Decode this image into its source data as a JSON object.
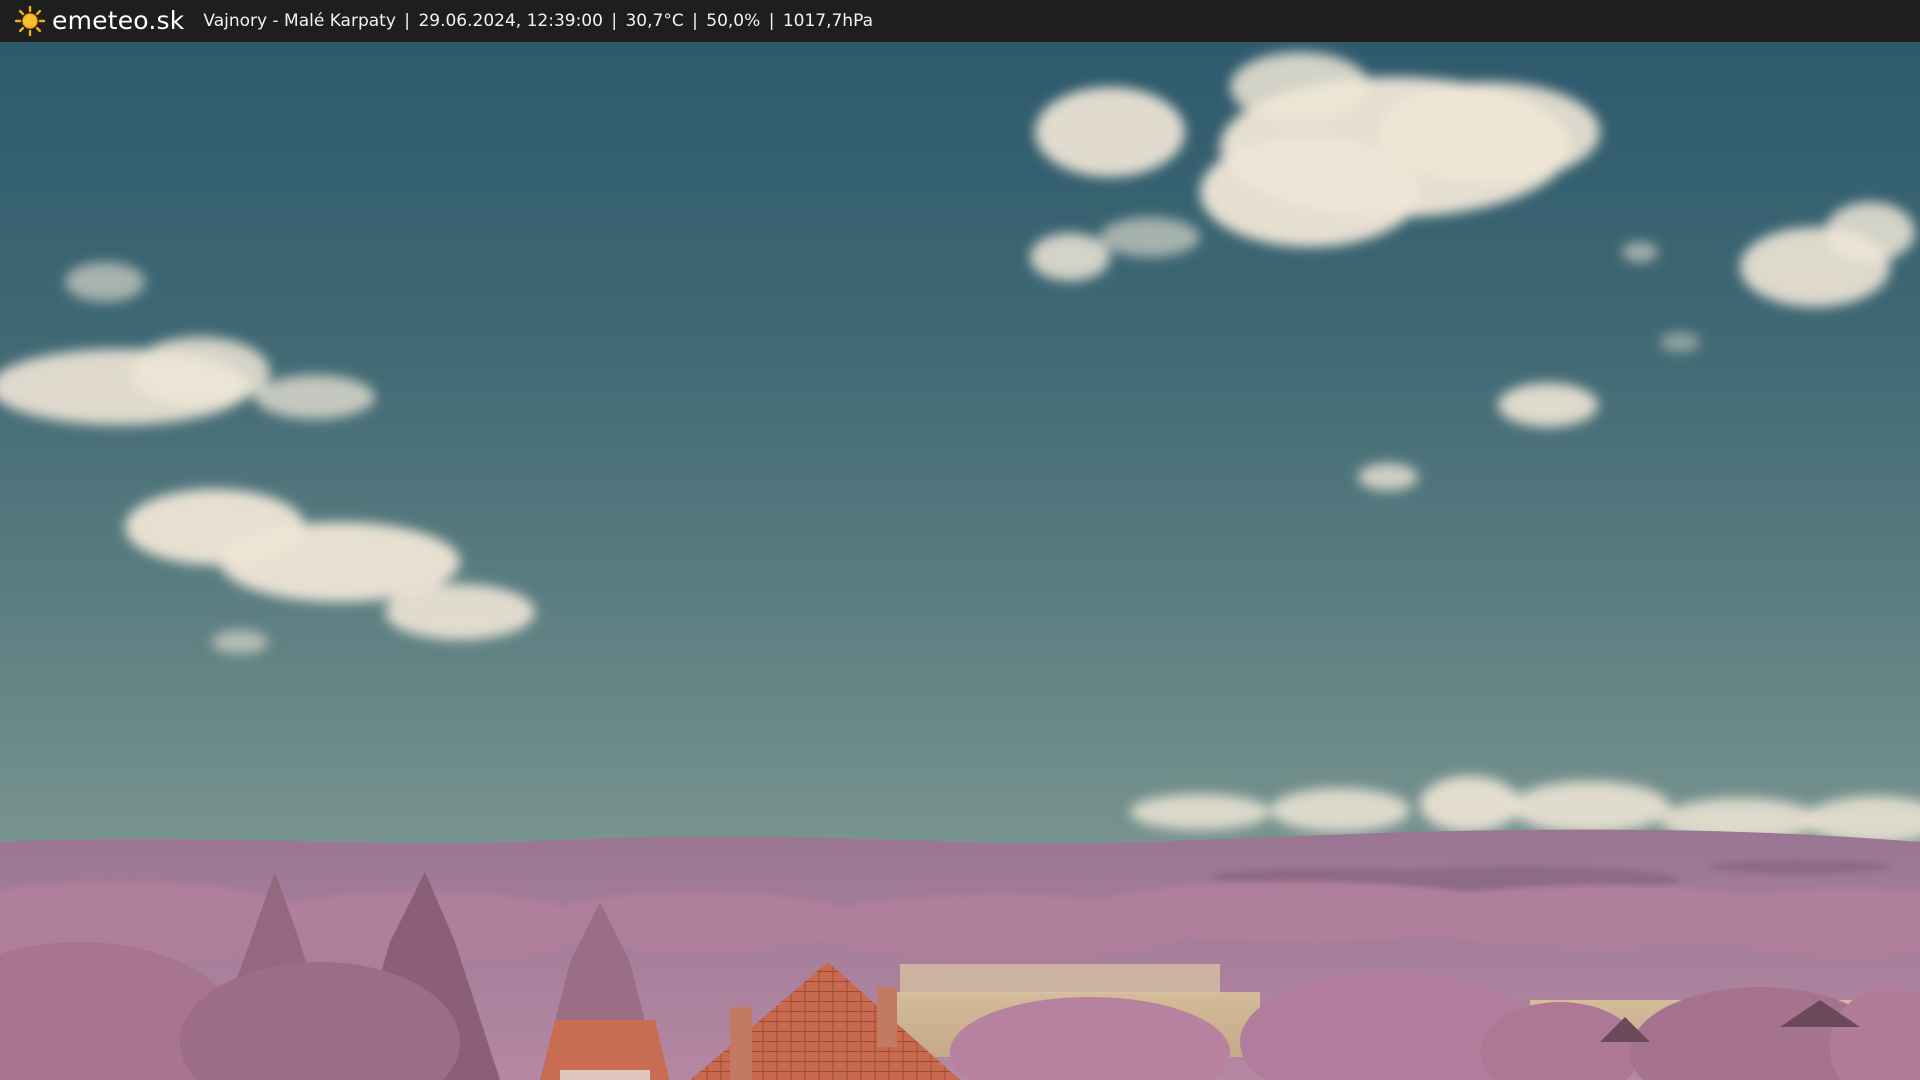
{
  "header": {
    "brand": "emeteo.sk",
    "location": "Vajnory - Malé Karpaty",
    "datetime": "29.06.2024, 12:39:00",
    "temperature": "30,7°C",
    "humidity": "50,0%",
    "pressure": "1017,7hPa",
    "separator": "|",
    "logo_icon": "sun-icon"
  },
  "colors": {
    "bar_background": "#1e1e1e",
    "sun": "#f5b21d",
    "sky_top": "#2f5a6b",
    "sky_bottom": "#6e8c8a",
    "cloud": "#efe6d6",
    "hills": "#a77f9a",
    "foliage": "#b07a98",
    "roof": "#c9684e",
    "field": "#cdb595"
  }
}
